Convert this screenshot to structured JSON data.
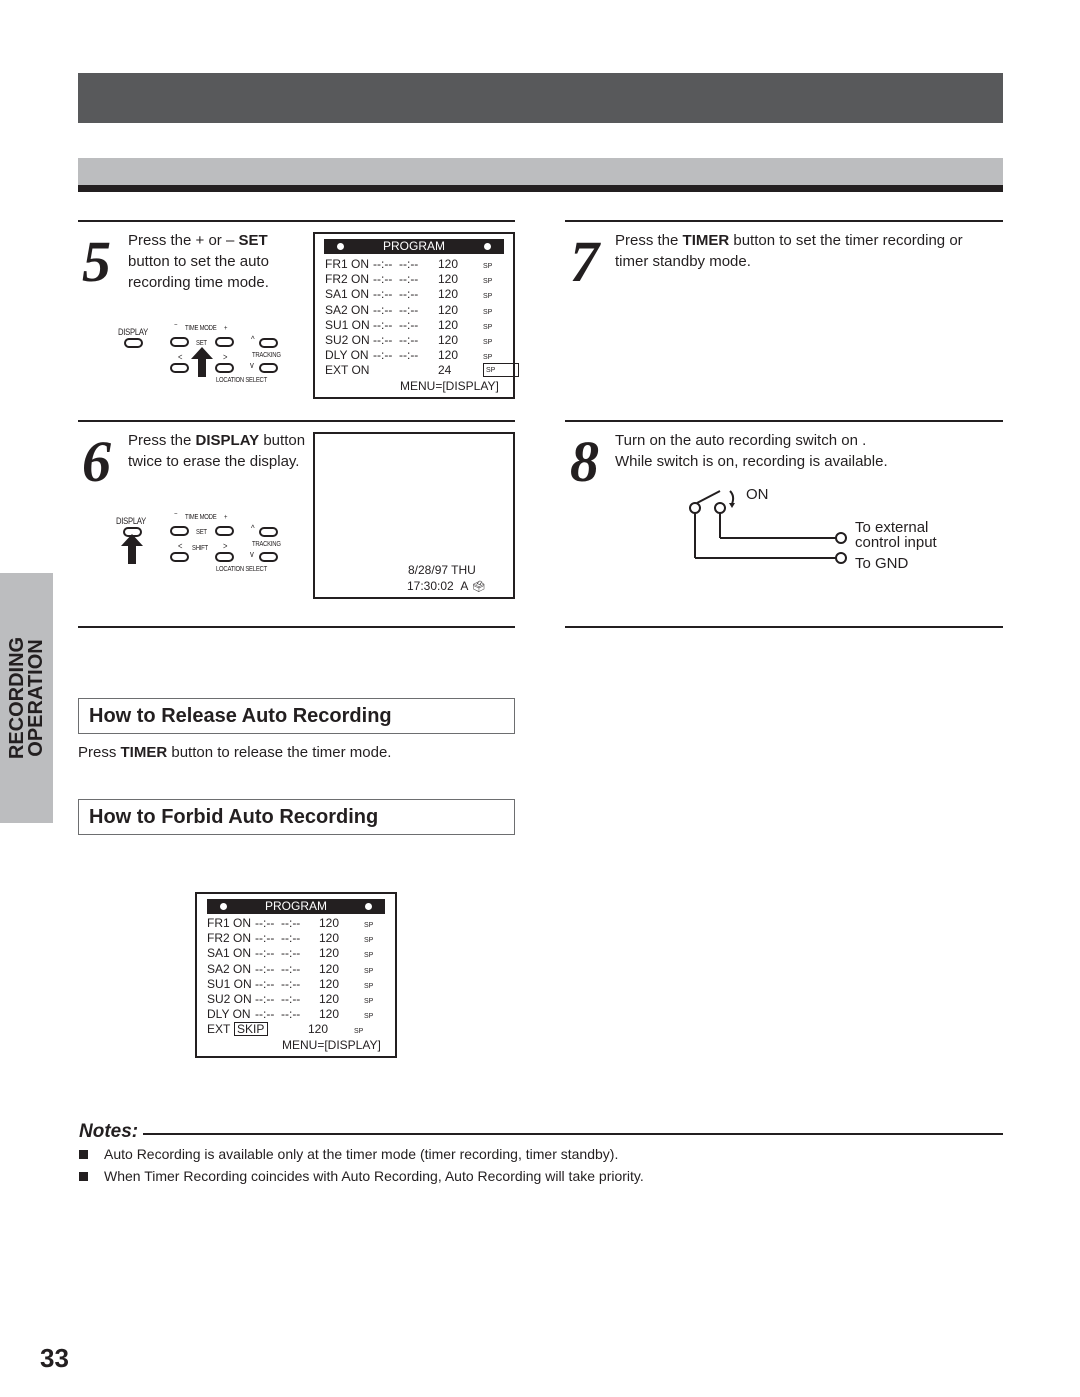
{
  "page": {
    "number": "33",
    "side_tab": {
      "line1": "RECORDING",
      "line2": "OPERATION"
    }
  },
  "colors": {
    "header_dark": "#58595b",
    "header_light": "#bcbdbf",
    "ink": "#231f20"
  },
  "steps": [
    {
      "number": "5",
      "text_pre": "Press the + or – ",
      "text_bold": "SET",
      "text_post": " button to set the auto recording time mode."
    },
    {
      "number": "6",
      "text_pre": "Press the ",
      "text_bold": "DISPLAY",
      "text_post": " button twice to erase the display."
    },
    {
      "number": "7",
      "text_pre": "Press the ",
      "text_bold": "TIMER",
      "text_post": " button to set the timer recording or timer standby mode."
    },
    {
      "number": "8",
      "line1": "Turn on the auto recording switch on .",
      "line2": "While switch is on, recording is available."
    }
  ],
  "remote": {
    "display": "DISPLAY",
    "time_mode": "TIME MODE",
    "set": "SET",
    "shift": "SHIFT",
    "tracking": "TRACKING",
    "location_select": "LOCATION SELECT",
    "minus": "−",
    "plus": "+",
    "left": "<",
    "right": ">",
    "up": "^",
    "down": "v"
  },
  "osd_program_step5": {
    "header": "PROGRAM",
    "rows": [
      {
        "label": "FR1 ON",
        "times": "--:--  --:--",
        "len": "120",
        "speed": "SP"
      },
      {
        "label": "FR2 ON",
        "times": "--:--  --:--",
        "len": "120",
        "speed": "SP"
      },
      {
        "label": "SA1 ON",
        "times": "--:--  --:--",
        "len": "120",
        "speed": "SP"
      },
      {
        "label": "SA2 ON",
        "times": "--:--  --:--",
        "len": "120",
        "speed": "SP"
      },
      {
        "label": "SU1 ON",
        "times": "--:--  --:--",
        "len": "120",
        "speed": "SP"
      },
      {
        "label": "SU2 ON",
        "times": "--:--  --:--",
        "len": "120",
        "speed": "SP"
      },
      {
        "label": "DLY ON",
        "times": "--:--  --:--",
        "len": "120",
        "speed": "SP"
      },
      {
        "label": "EXT ON",
        "times": "",
        "len": "24",
        "speed": "SP"
      }
    ],
    "footer": "MENU=[DISPLAY]"
  },
  "osd_clock_step6": {
    "date": "8/28/97 THU",
    "time": "17:30:02",
    "mode": "A",
    "extra": "²"
  },
  "switch_diagram": {
    "on_label": "ON",
    "external_line1": "To external",
    "external_line2": "control input",
    "gnd": "To GND"
  },
  "sections": {
    "release": {
      "title": "How to Release Auto Recording",
      "body_pre": "Press ",
      "body_bold": "TIMER",
      "body_post": " button to release the timer mode."
    },
    "forbid": {
      "title": "How to Forbid Auto Recording"
    }
  },
  "osd_program_forbid": {
    "header": "PROGRAM",
    "rows": [
      {
        "label": "FR1 ON",
        "times": "--:--  --:--",
        "len": "120",
        "speed": "SP"
      },
      {
        "label": "FR2 ON",
        "times": "--:--  --:--",
        "len": "120",
        "speed": "SP"
      },
      {
        "label": "SA1 ON",
        "times": "--:--  --:--",
        "len": "120",
        "speed": "SP"
      },
      {
        "label": "SA2 ON",
        "times": "--:--  --:--",
        "len": "120",
        "speed": "SP"
      },
      {
        "label": "SU1 ON",
        "times": "--:--  --:--",
        "len": "120",
        "speed": "SP"
      },
      {
        "label": "SU2 ON",
        "times": "--:--  --:--",
        "len": "120",
        "speed": "SP"
      },
      {
        "label": "DLY ON",
        "times": "--:--  --:--",
        "len": "120",
        "speed": "SP"
      }
    ],
    "ext_label": "EXT",
    "ext_value": "SKIP",
    "ext_len": "120",
    "ext_speed": "SP",
    "footer": "MENU=[DISPLAY]"
  },
  "notes": {
    "title": "Notes:",
    "items": [
      "Auto Recording is available only at the timer mode (timer recording, timer standby).",
      "When Timer Recording coincides with Auto Recording, Auto Recording will take priority."
    ]
  }
}
